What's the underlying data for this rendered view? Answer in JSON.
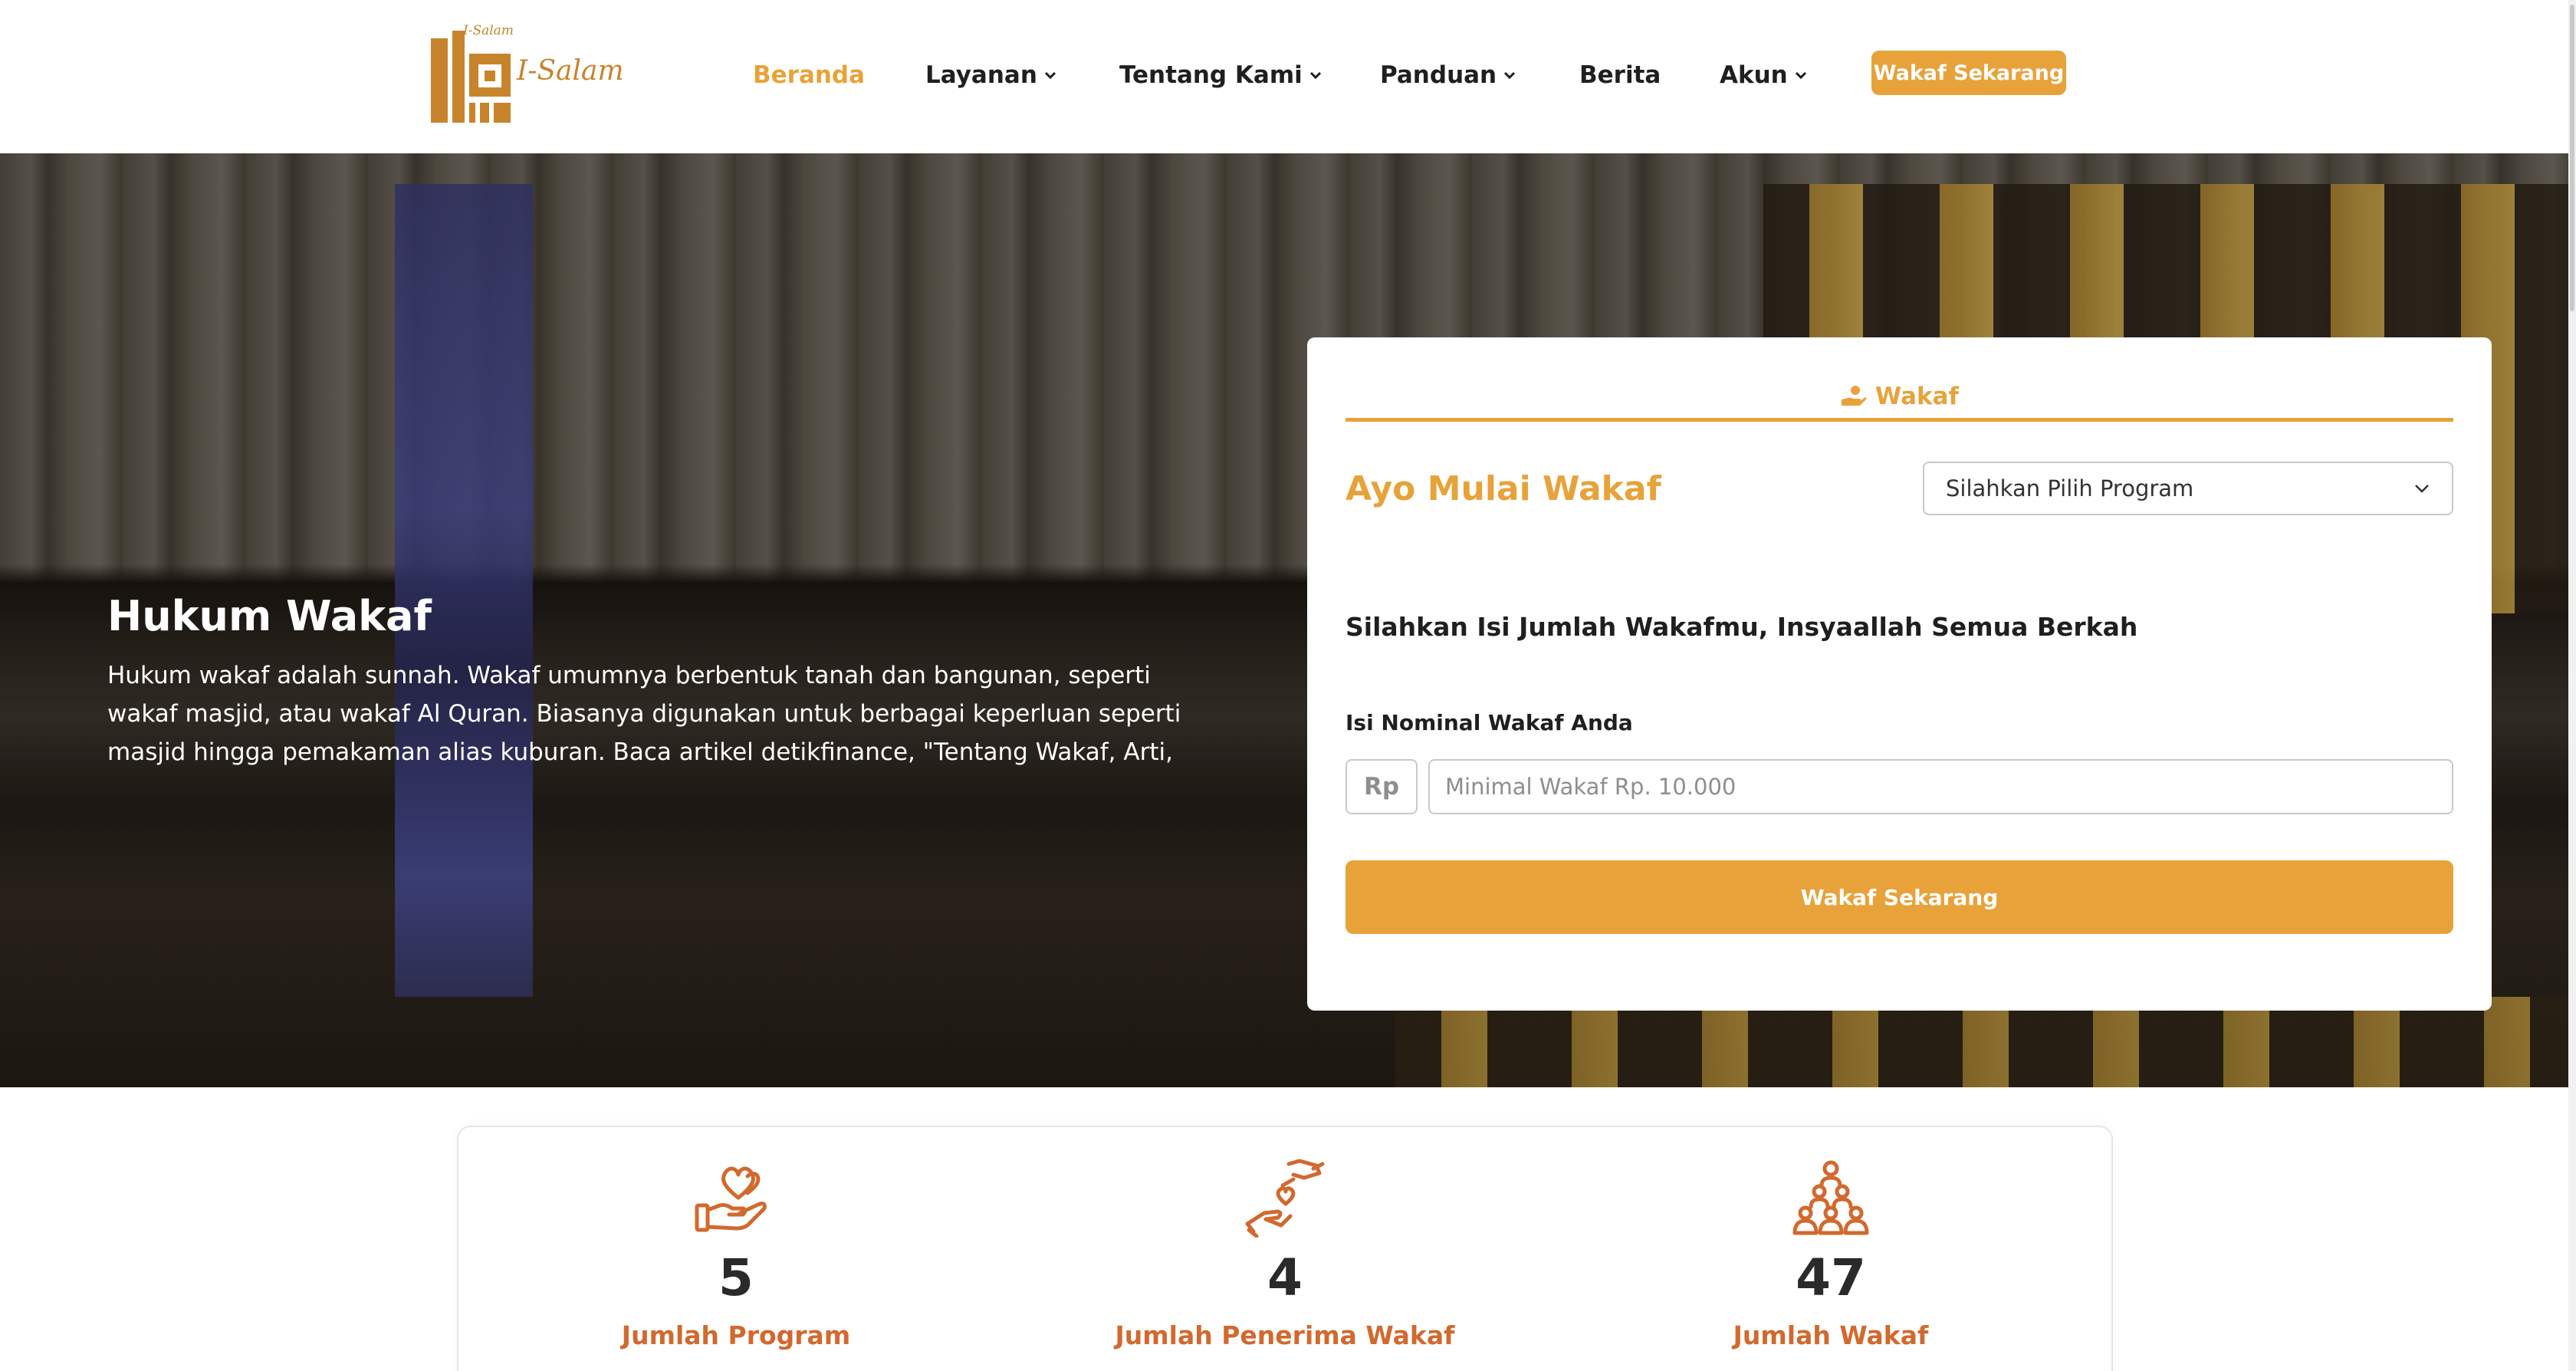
{
  "nav": {
    "logo_small": "I-Salam",
    "logo_text": "I-Salam",
    "items": [
      {
        "label": "Beranda",
        "active": true
      },
      {
        "label": "Layanan",
        "dropdown": true
      },
      {
        "label": "Tentang Kami",
        "dropdown": true
      },
      {
        "label": "Panduan",
        "dropdown": true
      },
      {
        "label": "Berita"
      },
      {
        "label": "Akun",
        "dropdown": true
      }
    ],
    "cta": "Wakaf Sekarang"
  },
  "hero": {
    "title": "Hukum Wakaf",
    "text": "Hukum wakaf adalah sunnah. Wakaf umumnya berbentuk tanah dan bangunan, seperti wakaf masjid, atau wakaf Al Quran. Biasanya digunakan untuk berbagai keperluan seperti masjid hingga pemakaman alias kuburan. Baca artikel detikfinance, \"Tentang Wakaf, Arti,"
  },
  "form": {
    "tab_label": "Wakaf",
    "heading": "Ayo Mulai Wakaf",
    "program_select": "Silahkan Pilih Program",
    "subheading": "Silahkan Isi Jumlah Wakafmu, Insyaallah Semua Berkah",
    "amount_label": "Isi Nominal Wakaf Anda",
    "currency": "Rp",
    "amount_placeholder": "Minimal Wakaf Rp. 10.000",
    "submit": "Wakaf Sekarang"
  },
  "stats": [
    {
      "icon": "heart-hand-icon",
      "value": "5",
      "label": "Jumlah Program"
    },
    {
      "icon": "giving-hands-icon",
      "value": "4",
      "label": "Jumlah Penerima Wakaf"
    },
    {
      "icon": "people-group-icon",
      "value": "47",
      "label": "Jumlah Wakaf"
    }
  ],
  "colors": {
    "accent": "#e7a33a",
    "stat_accent": "#d2692e",
    "text_dark": "#1f1f1f"
  }
}
